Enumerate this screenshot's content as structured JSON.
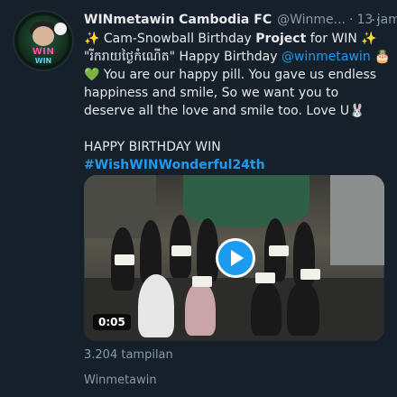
{
  "tweet": {
    "display_name": "WINmetawin Cambodia FC",
    "handle": "@Winme...",
    "dot": "·",
    "time": "13 jam",
    "more_icon": "more-dots-icon",
    "line1": {
      "emoji_left": "✨",
      "text": " Cam-Snowball Birthday ",
      "bold": "Project",
      "tail": " for WIN ",
      "emoji_right": "✨"
    },
    "line2": {
      "khmer": "\"រីករាយថ្ងៃកំណើត\"",
      "text": " Happy Birthday ",
      "mention": "@winmetawin",
      "emoji": "🎂"
    },
    "paragraph": "💚 You are our happy pill. You gave us endless happiness and smile, So we want you to deserve all the love and smile too. Love U🐰",
    "line_happy": "HAPPY BIRTHDAY WIN",
    "hashtag": "#WishWINWonderful24th",
    "media": {
      "duration": "0:05",
      "play_icon": "play-icon"
    },
    "views": "3.204 tampilan",
    "caption": "Winmetawin"
  },
  "avatar": {
    "word1": "WIN",
    "word2": "WIN"
  },
  "colors": {
    "background": "#15202b",
    "accent": "#1d9bf0",
    "secondary_text": "#8b98a5"
  }
}
